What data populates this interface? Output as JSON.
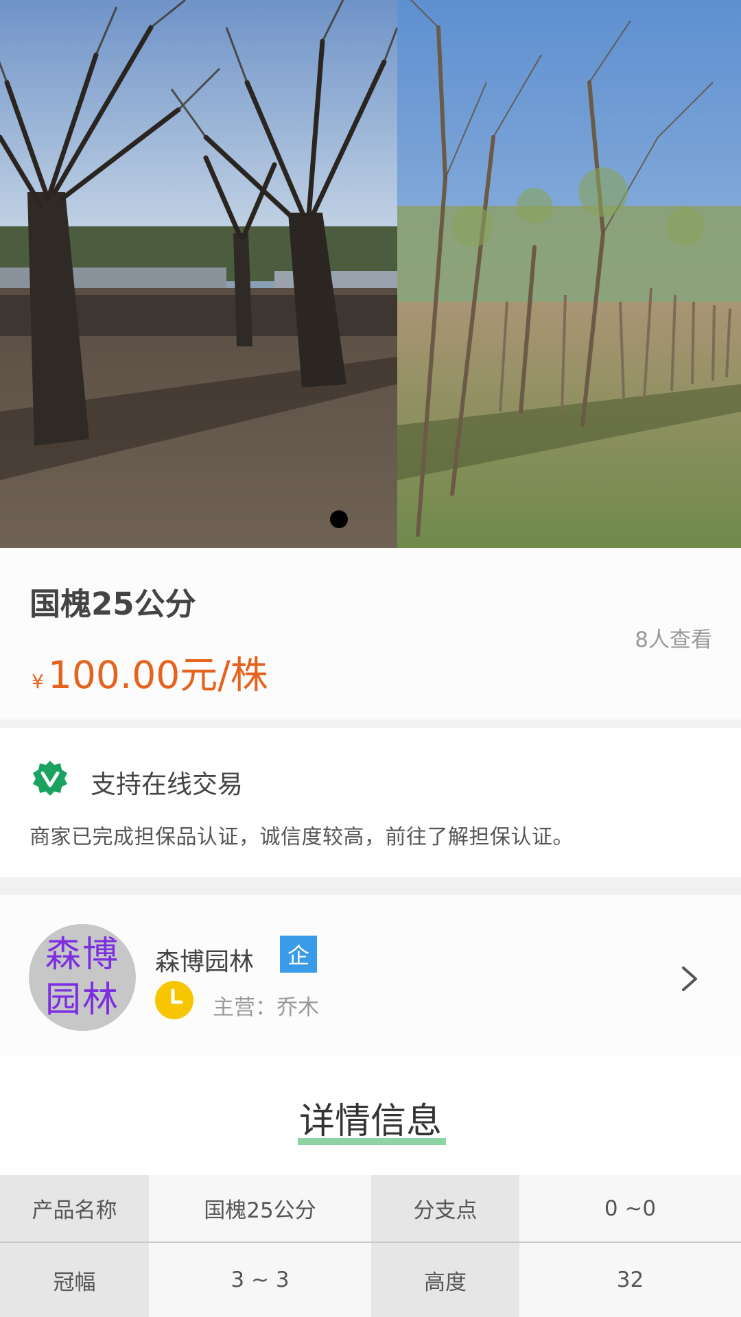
{
  "gallery": {
    "images": [
      "tree-field-photo",
      "sapling-grove-photo"
    ],
    "active_index": 0
  },
  "product": {
    "title": "国槐25公分",
    "currency": "¥",
    "price": "100.00",
    "unit": "元/株",
    "views": "8人查看"
  },
  "guarantee": {
    "icon": "verified-badge-icon",
    "title": "支持在线交易",
    "description": "商家已完成担保品认证，诚信度较高，前往了解担保认证。"
  },
  "store": {
    "avatar_text_line1": "森博",
    "avatar_text_line2": "园林",
    "name": "森博园林",
    "badge": "企",
    "main_business": "主营：乔木",
    "clock_icon": "clock-icon",
    "arrow_icon": "chevron-right-icon"
  },
  "details": {
    "title": "详情信息",
    "rows": [
      [
        {
          "key": "产品名称",
          "value": "国槐25公分"
        },
        {
          "key": "分支点",
          "value": "0 ~0"
        }
      ],
      [
        {
          "key": "冠幅",
          "value": "3 ~ 3"
        },
        {
          "key": "高度",
          "value": "32"
        }
      ]
    ]
  },
  "colors": {
    "price": "#e5631c",
    "badge": "#3a9be8",
    "guarantee_green": "#1aa260",
    "clock_yellow": "#f7c600",
    "underline": "#8ed3a4",
    "avatar_text": "#7c2fe0"
  }
}
